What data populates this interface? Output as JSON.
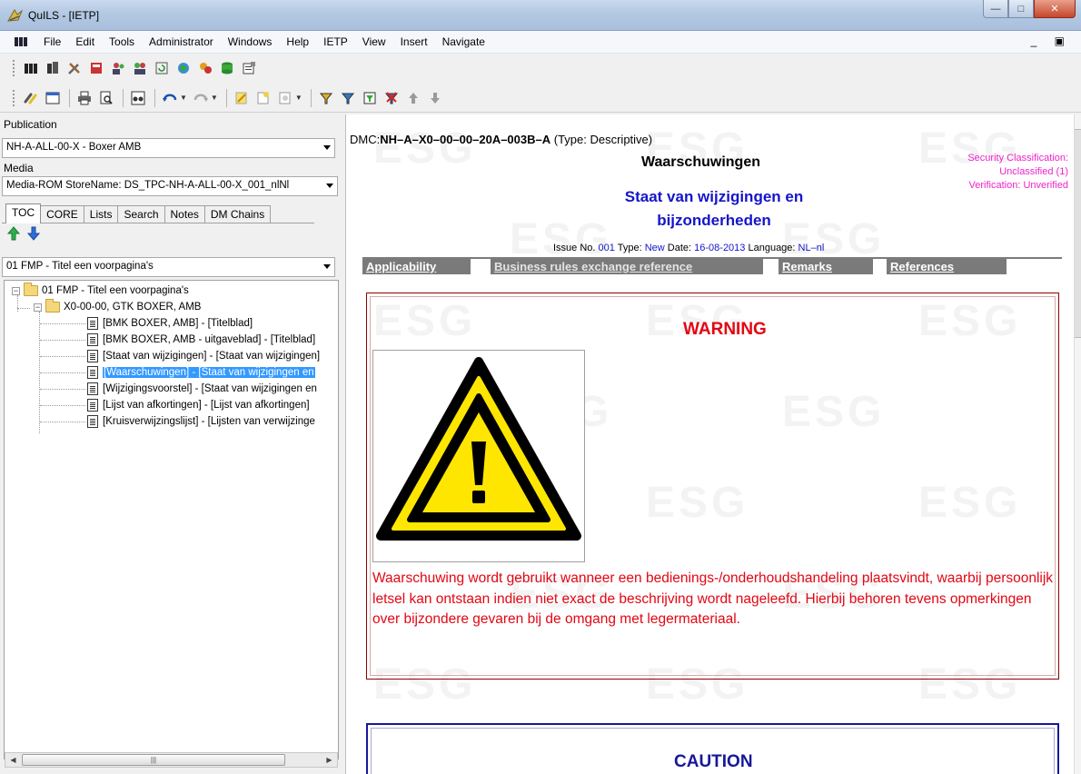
{
  "window": {
    "title": "QuILS - [IETP]",
    "controls": [
      "minimize",
      "maximize",
      "close"
    ]
  },
  "menubar": {
    "items": [
      "File",
      "Edit",
      "Tools",
      "Administrator",
      "Windows",
      "Help",
      "IETP",
      "View",
      "Insert",
      "Navigate"
    ]
  },
  "left_panel": {
    "publication_label": "Publication",
    "publication_value": "NH-A-ALL-00-X - Boxer AMB",
    "media_label": "Media",
    "media_value": "Media-ROM StoreName: DS_TPC-NH-A-ALL-00-X_001_nlNl",
    "tabs": [
      "TOC",
      "CORE",
      "Lists",
      "Search",
      "Notes",
      "DM Chains"
    ],
    "active_tab": "TOC",
    "toc_select": "01 FMP - Titel een voorpagina's",
    "tree": {
      "root": "01 FMP - Titel een voorpagina's",
      "folder": "X0-00-00, GTK BOXER, AMB",
      "items": [
        "[BMK BOXER, AMB] - [Titelblad]",
        "[BMK BOXER, AMB - uitgaveblad] - [Titelblad]",
        "[Staat van wijzigingen] - [Staat van wijzigingen]",
        "[Waarschuwingen] - [Staat van wijzigingen en",
        "[Wijzigingsvoorstel] - [Staat van wijzigingen en",
        "[Lijst van afkortingen] - [Lijst van afkortingen]",
        "[Kruisverwijzingslijst] - [Lijsten van verwijzinge"
      ],
      "selected_index": 3
    }
  },
  "document": {
    "dmc_prefix": "DMC:",
    "dmc_code": "NH–A–X0–00–00–20A–003B–A",
    "dmc_type": " (Type: Descriptive)",
    "title": "Waarschuwingen",
    "subtitle_line1": "Staat van wijzigingen en",
    "subtitle_line2": "bijzonderheden",
    "security_line1": "Security Classification:",
    "security_line2": "Unclassified (1)",
    "security_line3": "Verification: Unverified",
    "issue_label": "Issue No. ",
    "issue_no": "001",
    "type_label": " Type: ",
    "type_value": "New",
    "date_label": " Date: ",
    "date_value": "16-08-2013",
    "lang_label": " Language: ",
    "lang_value": "NL–nl",
    "tabs": [
      "Applicability",
      "Business rules exchange reference",
      "Remarks",
      "References"
    ],
    "watermark": "ESG",
    "warning_heading": "WARNING",
    "warning_text": "Waarschuwing wordt gebruikt wanneer een bedienings-/onderhoudshandeling plaatsvindt, waarbij persoonlijk letsel kan ontstaan indien niet exact de beschrijving wordt nageleefd. Hierbij behoren tevens opmerkingen over bijzondere gevaren bij de omgang met legermateriaal.",
    "caution_heading": "CAUTION"
  },
  "colors": {
    "warning_red": "#e30613",
    "caution_blue": "#17179a",
    "security_magenta": "#ee22cc",
    "link_blue": "#1414cc",
    "selection": "#3399ff"
  }
}
